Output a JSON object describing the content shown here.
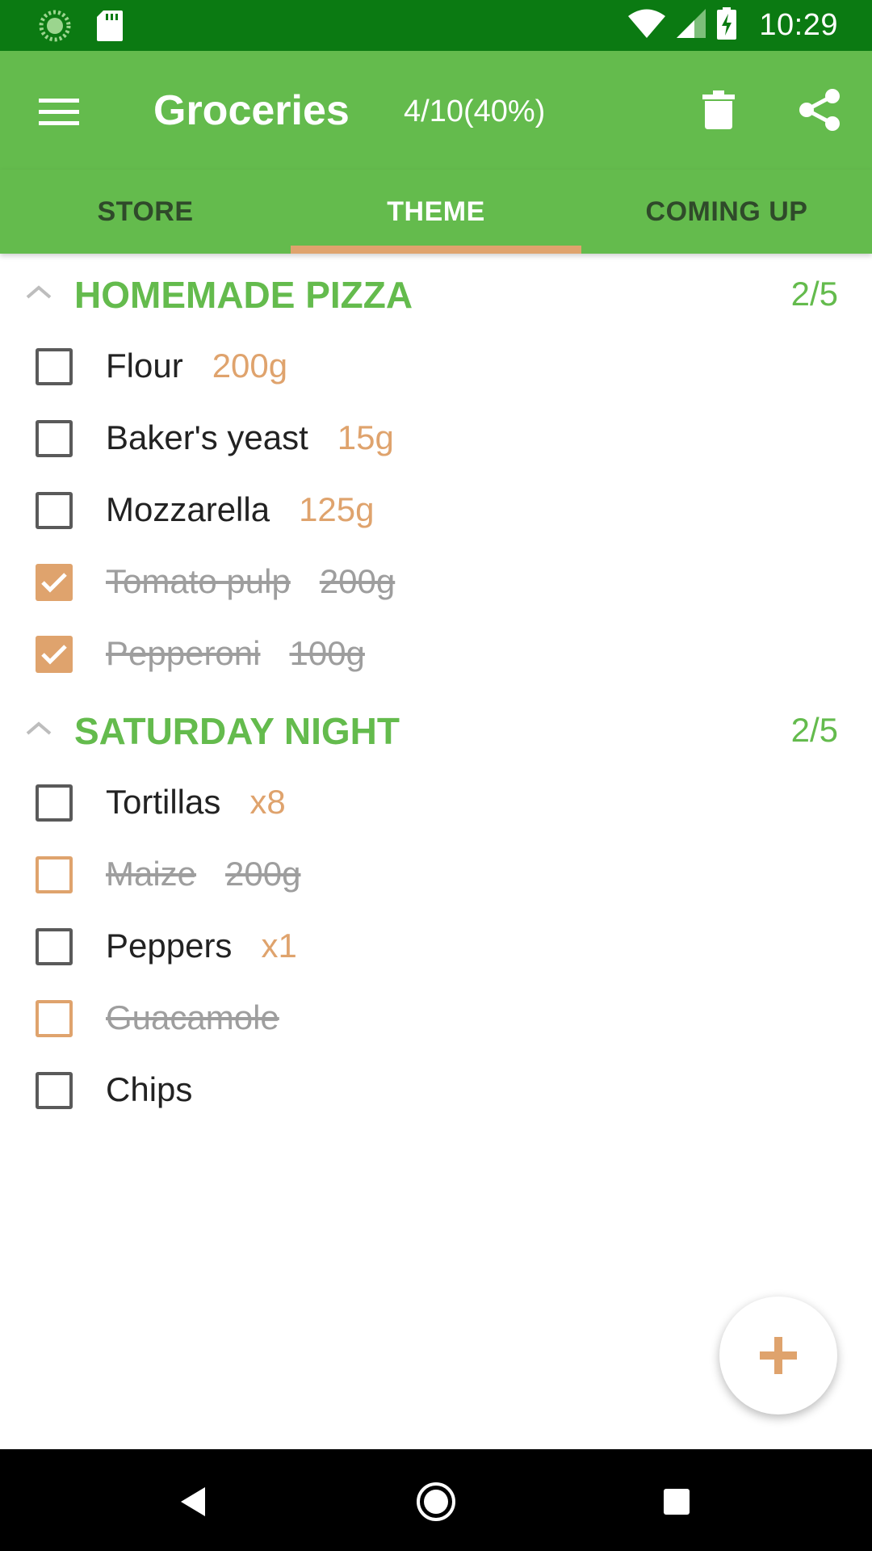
{
  "status_bar": {
    "time": "10:29",
    "icons": [
      "sync-icon",
      "sd-card-icon",
      "wifi-icon",
      "signal-icon",
      "battery-charging-icon"
    ]
  },
  "app_bar": {
    "title": "Groceries",
    "progress": "4/10(40%)",
    "icons": [
      "menu-icon",
      "trash-icon",
      "share-icon"
    ]
  },
  "tabs": [
    {
      "label": "STORE",
      "active": false
    },
    {
      "label": "THEME",
      "active": true
    },
    {
      "label": "COMING UP",
      "active": false
    }
  ],
  "sections": [
    {
      "title": "HOMEMADE PIZZA",
      "count": "2/5",
      "items": [
        {
          "name": "Flour",
          "qty": "200g",
          "checked": false,
          "struck": false
        },
        {
          "name": "Baker's yeast",
          "qty": "15g",
          "checked": false,
          "struck": false
        },
        {
          "name": "Mozzarella",
          "qty": "125g",
          "checked": false,
          "struck": false
        },
        {
          "name": "Tomato pulp",
          "qty": "200g",
          "checked": true,
          "struck": true
        },
        {
          "name": "Pepperoni",
          "qty": "100g",
          "checked": true,
          "struck": true
        }
      ]
    },
    {
      "title": "SATURDAY NIGHT",
      "count": "2/5",
      "items": [
        {
          "name": "Tortillas",
          "qty": "x8",
          "checked": false,
          "struck": false
        },
        {
          "name": "Maize",
          "qty": "200g",
          "checked": false,
          "struck": true
        },
        {
          "name": "Peppers",
          "qty": "x1",
          "checked": false,
          "struck": false
        },
        {
          "name": "Guacamole",
          "qty": "",
          "checked": false,
          "struck": true
        },
        {
          "name": "Chips",
          "qty": "",
          "checked": false,
          "struck": false
        }
      ]
    }
  ],
  "fab": {
    "icon": "plus-icon"
  },
  "nav_bar": {
    "icons": [
      "back-icon",
      "home-icon",
      "recents-icon"
    ]
  },
  "colors": {
    "status_bar": "#0b7a12",
    "primary": "#64bb4d",
    "accent": "#dfa36d",
    "text": "#222222",
    "struck_text": "#9e9e9e"
  }
}
